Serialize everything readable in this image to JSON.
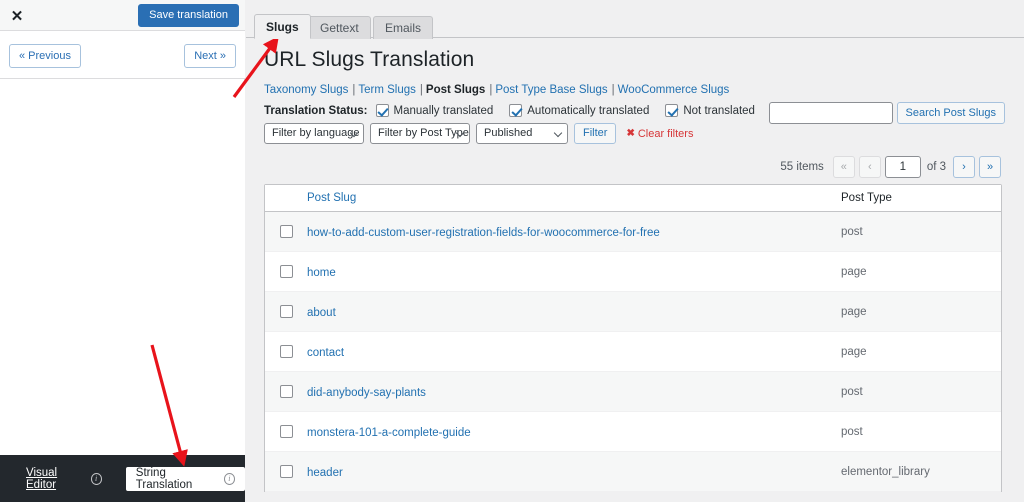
{
  "left_panel": {
    "close_icon": "✕",
    "save_label": "Save translation",
    "prev_label": "« Previous",
    "next_label": "Next »",
    "visual_editor_label": "Visual Editor",
    "string_translation_label": "String Translation",
    "info_glyph": "i",
    "accent_blue": "#2a6fb4",
    "bottom_bar_color": "#23282d"
  },
  "tabs": [
    {
      "label": "Slugs",
      "active": true
    },
    {
      "label": "Gettext",
      "active": false
    },
    {
      "label": "Emails",
      "active": false
    }
  ],
  "page": {
    "title": "URL Slugs Translation"
  },
  "subnav": [
    {
      "label": "Taxonomy Slugs",
      "current": false
    },
    {
      "label": "Term Slugs",
      "current": false
    },
    {
      "label": "Post Slugs",
      "current": true
    },
    {
      "label": "Post Type Base Slugs",
      "current": false
    },
    {
      "label": "WooCommerce Slugs",
      "current": false
    }
  ],
  "translation_status": {
    "label": "Translation Status:",
    "options": [
      {
        "label": "Manually translated",
        "checked": true
      },
      {
        "label": "Automatically translated",
        "checked": true
      },
      {
        "label": "Not translated",
        "checked": true
      }
    ]
  },
  "filters": {
    "language_select": "Filter by language",
    "post_type_select": "Filter by Post Type",
    "status_select": "Published",
    "filter_button": "Filter",
    "clear_filters": "Clear filters",
    "clear_filters_glyph": "✖",
    "clear_filters_color": "#d63638"
  },
  "search": {
    "value": "",
    "placeholder": "",
    "button_label": "Search Post Slugs"
  },
  "pagination": {
    "items_label": "55 items",
    "first_glyph": "«",
    "prev_glyph": "‹",
    "current_page": "1",
    "of_label": "of 3",
    "next_glyph": "›",
    "last_glyph": "»"
  },
  "table": {
    "columns": [
      "Post Slug",
      "Post Type"
    ],
    "rows": [
      {
        "slug": "how-to-add-custom-user-registration-fields-for-woocommerce-for-free",
        "type": "post"
      },
      {
        "slug": "home",
        "type": "page"
      },
      {
        "slug": "about",
        "type": "page"
      },
      {
        "slug": "contact",
        "type": "page"
      },
      {
        "slug": "did-anybody-say-plants",
        "type": "post"
      },
      {
        "slug": "monstera-101-a-complete-guide",
        "type": "post"
      },
      {
        "slug": "header",
        "type": "elementor_library"
      }
    ]
  },
  "annotations": {
    "arrow_color": "#e8131b",
    "arrow_count": 2
  }
}
